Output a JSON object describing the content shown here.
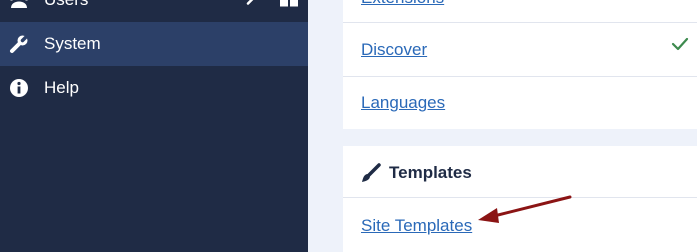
{
  "sidebar": {
    "items": [
      {
        "label": "Users",
        "icon": "users-icon"
      },
      {
        "label": "System",
        "icon": "wrench-icon"
      },
      {
        "label": "Help",
        "icon": "info-icon"
      }
    ],
    "active_color": "#2c4068",
    "background": "#1f2b45"
  },
  "main": {
    "system_links": [
      {
        "label": "Extensions"
      },
      {
        "label": "Discover",
        "status_icon": "checkmark-icon"
      },
      {
        "label": "Languages"
      }
    ],
    "templates": {
      "title": "Templates",
      "icon": "paintbrush-icon",
      "links": [
        {
          "label": "Site Templates"
        }
      ]
    },
    "annotation_arrow_color": "#8b1414",
    "link_color": "#2a69b8"
  }
}
